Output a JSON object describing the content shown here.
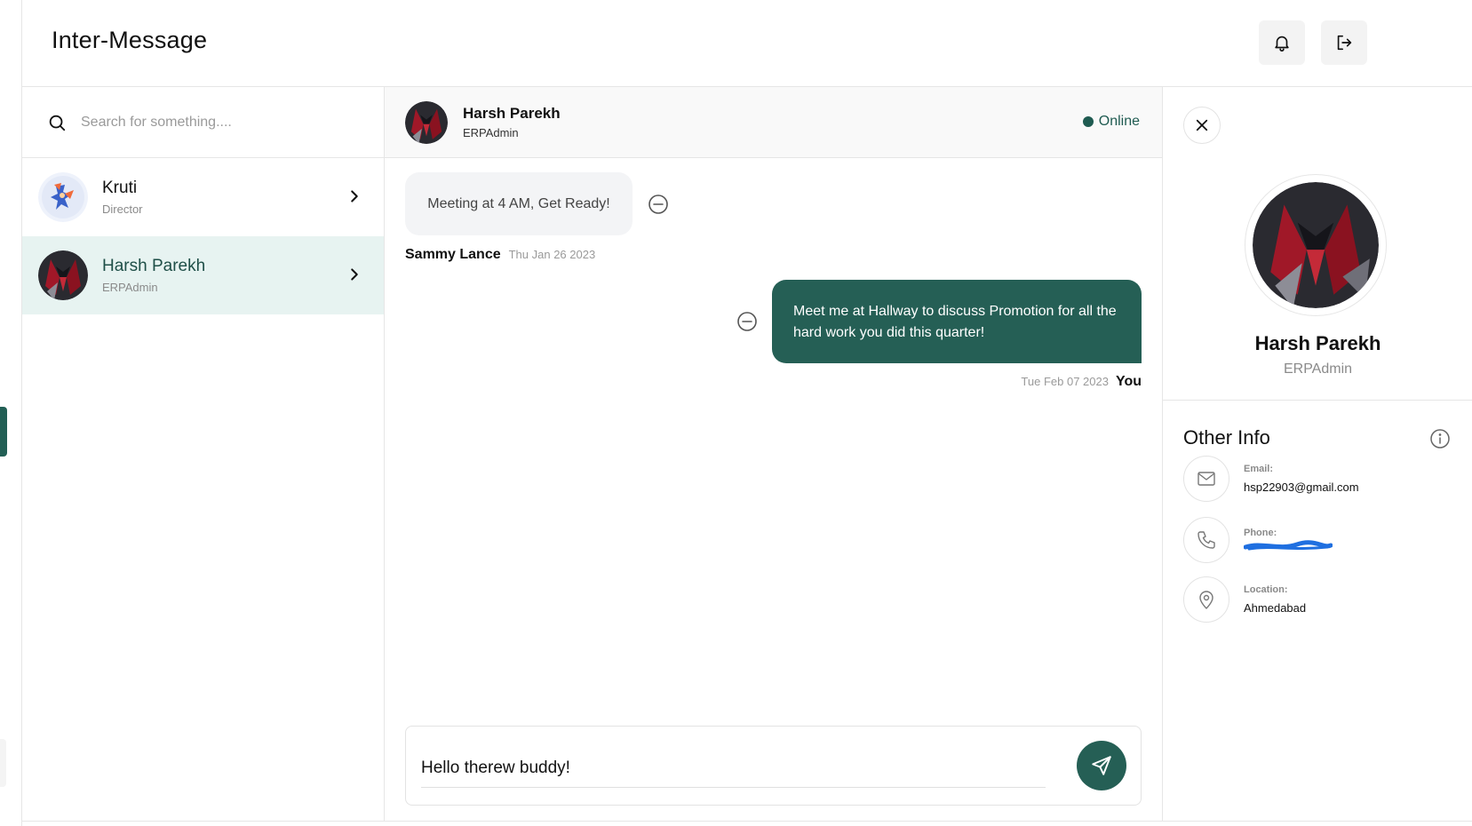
{
  "app": {
    "title": "Inter-Message",
    "colors": {
      "accent": "#255f55",
      "active_row": "#e7f3f1",
      "online": "#1f5b51"
    }
  },
  "header": {
    "notifications_icon": "bell-icon",
    "logout_icon": "logout-icon"
  },
  "search": {
    "placeholder": "Search for something....",
    "icon": "search-icon"
  },
  "contacts": [
    {
      "name": "Kruti",
      "role": "Director",
      "active": false
    },
    {
      "name": "Harsh Parekh",
      "role": "ERPAdmin",
      "active": true
    }
  ],
  "chat": {
    "contact_name": "Harsh Parekh",
    "contact_role": "ERPAdmin",
    "status": "Online",
    "messages": [
      {
        "direction": "incoming",
        "text": "Meeting at 4 AM, Get Ready!",
        "sender": "Sammy Lance",
        "date": "Thu Jan 26 2023"
      },
      {
        "direction": "outgoing",
        "text": "Meet me at Hallway to discuss Promotion for all the hard work you did this quarter!",
        "sender": "You",
        "date": "Tue Feb 07 2023"
      }
    ],
    "composer_value": "Hello therew buddy!",
    "send_icon": "send-icon"
  },
  "profile": {
    "name": "Harsh Parekh",
    "role": "ERPAdmin",
    "other_info_title": "Other Info",
    "email_label": "Email:",
    "email_value": "hsp22903@gmail.com",
    "phone_label": "Phone:",
    "location_label": "Location:",
    "location_value": "Ahmedabad"
  }
}
